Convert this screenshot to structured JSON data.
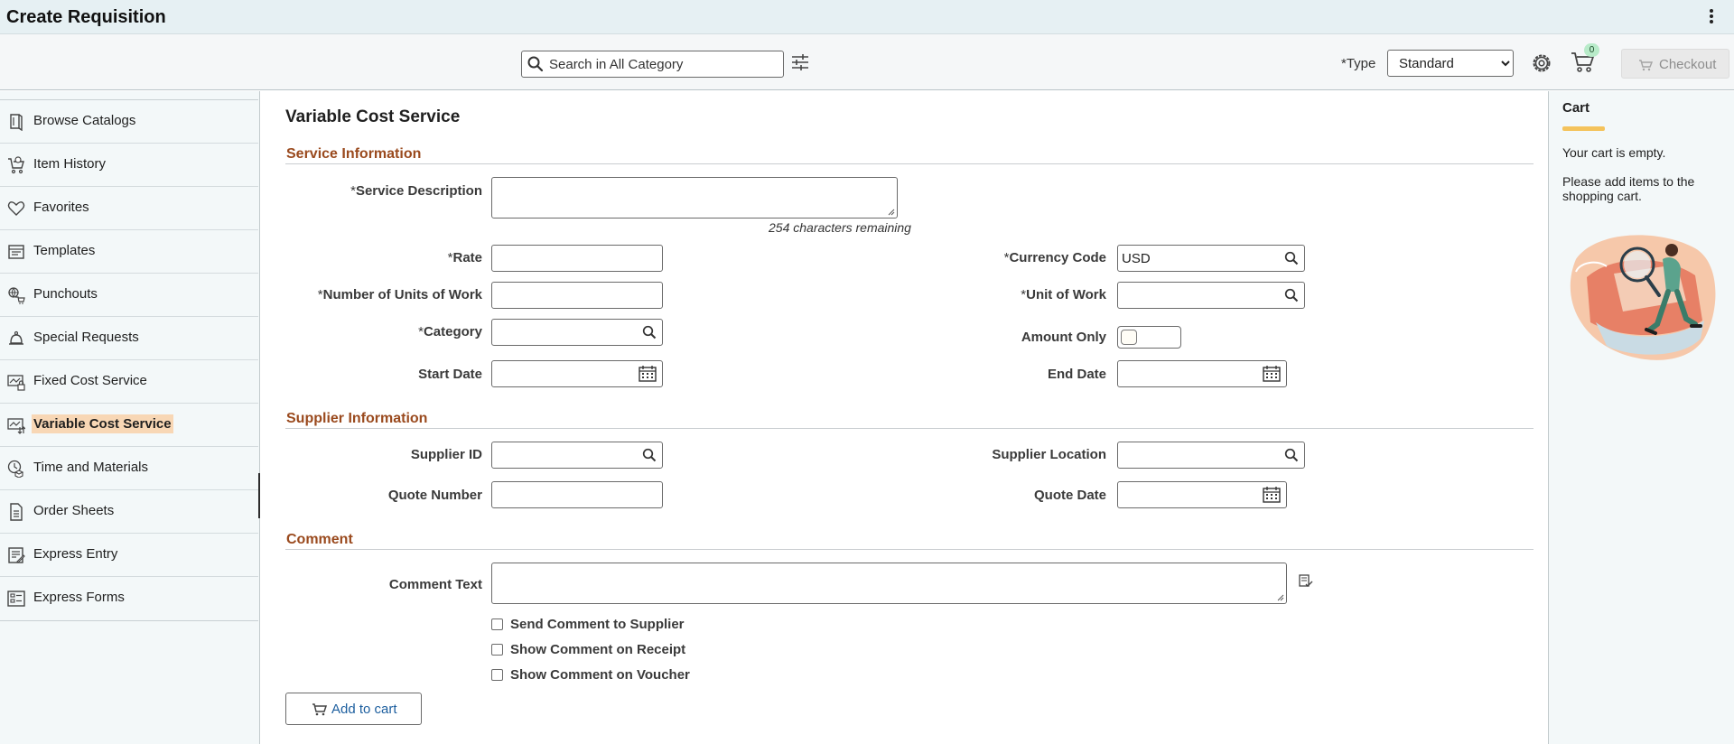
{
  "app": {
    "title": "Create Requisition"
  },
  "toolbar": {
    "search_placeholder": "Search in All Category",
    "type_label": "*Type",
    "type_value": "Standard",
    "cart_count": "0",
    "checkout_label": "Checkout"
  },
  "sidebar": {
    "items": [
      {
        "label": "Browse Catalogs",
        "icon": "book-icon"
      },
      {
        "label": "Item History",
        "icon": "cart-history-icon"
      },
      {
        "label": "Favorites",
        "icon": "heart-icon"
      },
      {
        "label": "Templates",
        "icon": "template-icon"
      },
      {
        "label": "Punchouts",
        "icon": "punchout-icon"
      },
      {
        "label": "Special Requests",
        "icon": "bell-icon"
      },
      {
        "label": "Fixed Cost Service",
        "icon": "fixed-cost-icon"
      },
      {
        "label": "Variable Cost Service",
        "icon": "variable-cost-icon",
        "active": true
      },
      {
        "label": "Time and Materials",
        "icon": "time-materials-icon"
      },
      {
        "label": "Order Sheets",
        "icon": "document-icon"
      },
      {
        "label": "Express Entry",
        "icon": "express-entry-icon"
      },
      {
        "label": "Express Forms",
        "icon": "form-icon"
      }
    ]
  },
  "main": {
    "page_title": "Variable Cost Service",
    "service_section": "Service Information",
    "supplier_section": "Supplier Information",
    "comment_section": "Comment",
    "labels": {
      "service_description": "Service Description",
      "rate": "Rate",
      "number_of_units": "Number of Units of Work",
      "category": "Category",
      "start_date": "Start Date",
      "currency_code": "Currency Code",
      "unit_of_work": "Unit of Work",
      "amount_only": "Amount Only",
      "end_date": "End Date",
      "supplier_id": "Supplier ID",
      "quote_number": "Quote Number",
      "supplier_location": "Supplier Location",
      "quote_date": "Quote Date",
      "comment_text": "Comment Text"
    },
    "required_marker": "*",
    "values": {
      "currency_code": "USD"
    },
    "chars_remaining": "254 characters remaining",
    "checkboxes": {
      "send_to_supplier": "Send Comment to Supplier",
      "show_on_receipt": "Show Comment on Receipt",
      "show_on_voucher": "Show Comment on Voucher"
    },
    "add_to_cart": "Add to cart"
  },
  "cart": {
    "title": "Cart",
    "empty": "Your cart is empty.",
    "message": "Please add items to the shopping cart.",
    "accent_color": "#f4c35c"
  },
  "colors": {
    "section_heading": "#9a4a1e",
    "active_nav": "#f8d7b5",
    "link": "#1c5e9e"
  }
}
